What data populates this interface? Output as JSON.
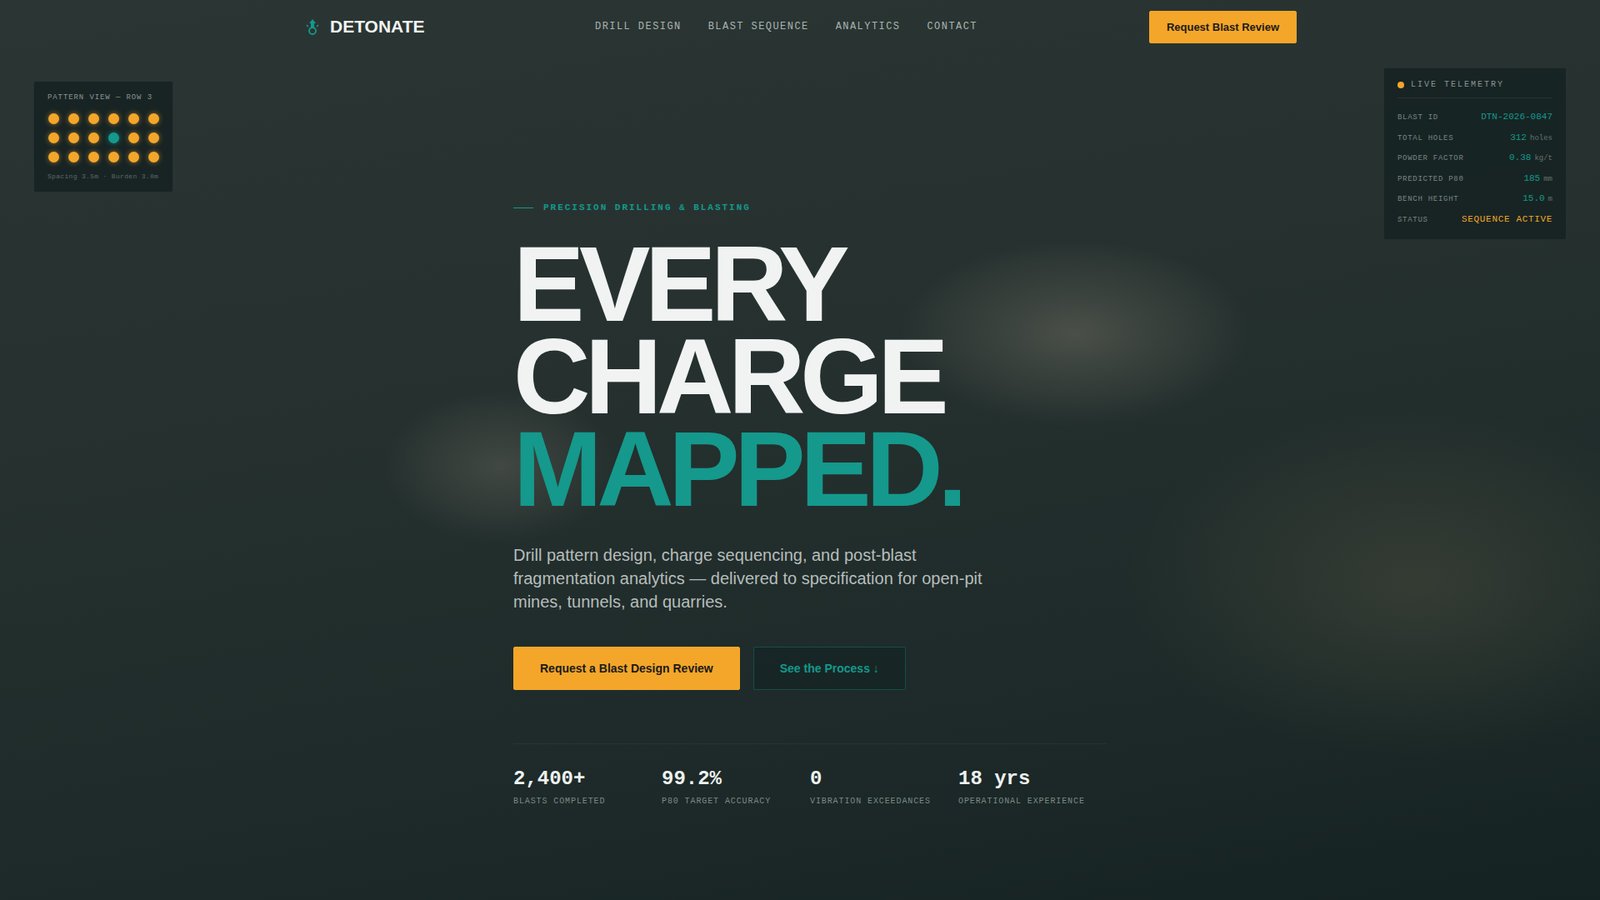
{
  "nav": {
    "brand": "DETONATE",
    "links": [
      "DRILL DESIGN",
      "BLAST SEQUENCE",
      "ANALYTICS",
      "CONTACT"
    ],
    "cta": "Request Blast Review"
  },
  "pattern": {
    "title": "PATTERN VIEW — ROW 3",
    "rows": [
      [
        {
          "selected": false
        },
        {
          "selected": false
        },
        {
          "selected": false
        },
        {
          "selected": false
        },
        {
          "selected": false
        },
        {
          "selected": false
        }
      ],
      [
        {
          "selected": false
        },
        {
          "selected": false
        },
        {
          "selected": false
        },
        {
          "selected": true
        },
        {
          "selected": false
        },
        {
          "selected": false
        }
      ],
      [
        {
          "selected": false
        },
        {
          "selected": false
        },
        {
          "selected": false
        },
        {
          "selected": false
        },
        {
          "selected": false
        },
        {
          "selected": false
        }
      ]
    ],
    "footer": "Spacing 3.5m · Burden 3.0m"
  },
  "telemetry": {
    "title": "LIVE TELEMETRY",
    "rows": [
      {
        "kind": "value",
        "label": "BLAST ID",
        "value": "DTN-2026-0847",
        "unit": ""
      },
      {
        "kind": "value",
        "label": "TOTAL HOLES",
        "value": "312",
        "unit": "holes"
      },
      {
        "kind": "value",
        "label": "POWDER FACTOR",
        "value": "0.38",
        "unit": "kg/t"
      },
      {
        "kind": "value",
        "label": "PREDICTED P80",
        "value": "185",
        "unit": "mm"
      },
      {
        "kind": "value",
        "label": "BENCH HEIGHT",
        "value": "15.0",
        "unit": "m"
      },
      {
        "kind": "status",
        "label": "STATUS",
        "value": "SEQUENCE ACTIVE",
        "unit": ""
      }
    ]
  },
  "hero": {
    "eyebrow": "PRECISION DRILLING & BLASTING",
    "headline": [
      "EVERY",
      "CHARGE"
    ],
    "accent": "MAPPED.",
    "subtitle": "Drill pattern design, charge sequencing, and post-blast fragmentation analytics — delivered to specification for open-pit mines, tunnels, and quarries.",
    "primary": "Request a Blast Design Review",
    "secondary": "See the Process ↓"
  },
  "stats": [
    {
      "value": "2,400+",
      "label": "BLASTS COMPLETED"
    },
    {
      "value": "99.2%",
      "label": "P80 TARGET ACCURACY"
    },
    {
      "value": "0",
      "label": "VIBRATION EXCEEDANCES"
    },
    {
      "value": "18 yrs",
      "label": "OPERATIONAL EXPERIENCE"
    }
  ]
}
